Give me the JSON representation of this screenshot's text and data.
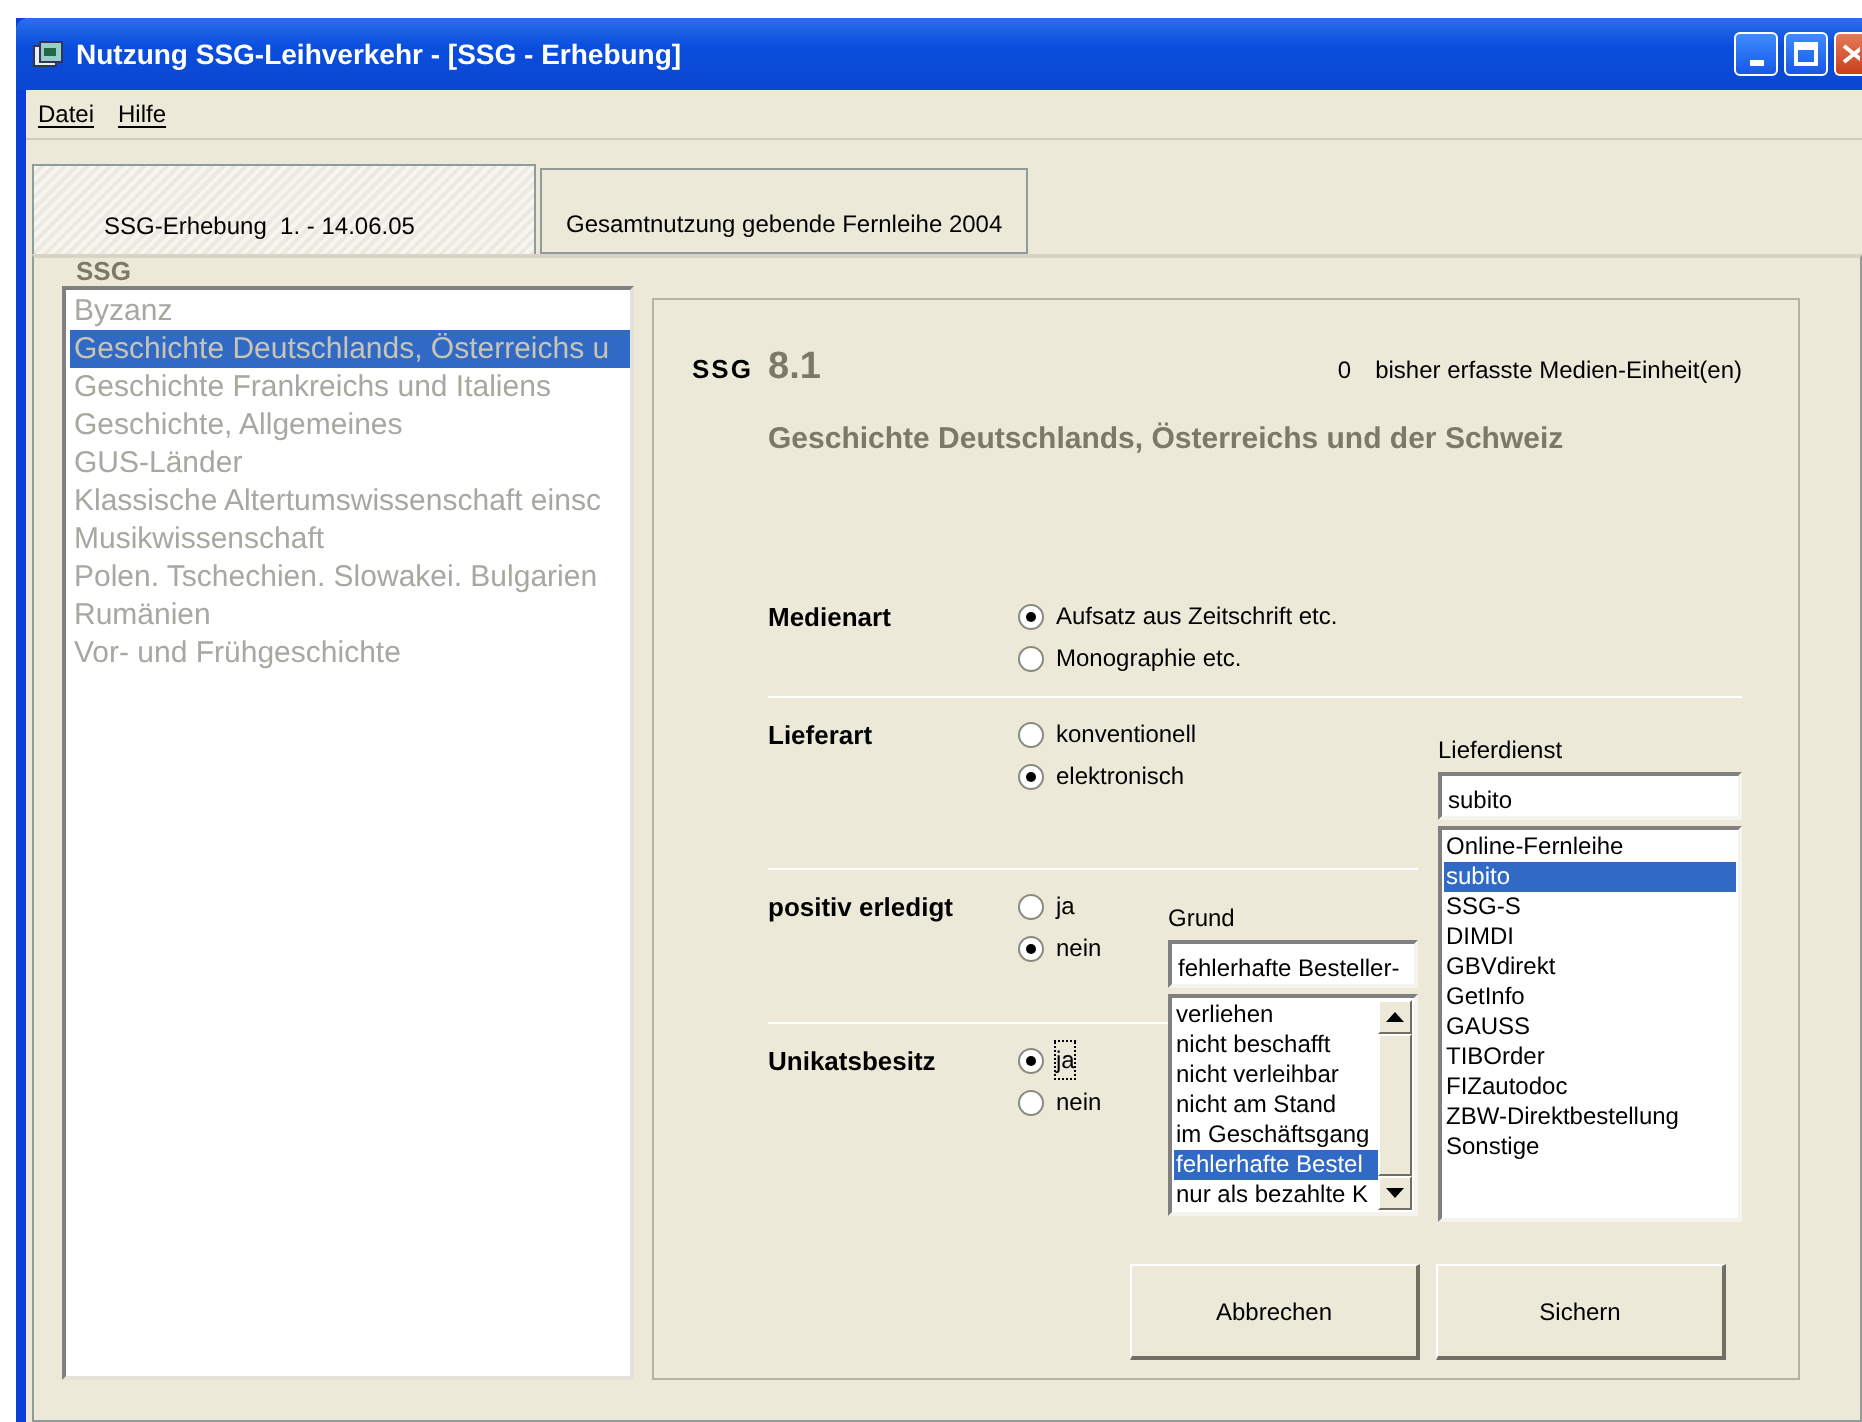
{
  "window": {
    "title": "Nutzung SSG-Leihverkehr - [SSG - Erhebung]"
  },
  "menu": [
    "Datei",
    "Hilfe"
  ],
  "tabs": [
    {
      "label": "SSG-Erhebung  1. - 14.06.05",
      "selected": true
    },
    {
      "label": "Gesamtnutzung gebende Fernleihe 2004",
      "selected": false
    }
  ],
  "ssg_list": {
    "label": "SSG",
    "items": [
      {
        "label": "Byzanz",
        "selected": false
      },
      {
        "label": "Geschichte Deutschlands, Österreichs u",
        "selected": true
      },
      {
        "label": "Geschichte Frankreichs und Italiens",
        "selected": false
      },
      {
        "label": "Geschichte, Allgemeines",
        "selected": false
      },
      {
        "label": "GUS-Länder",
        "selected": false
      },
      {
        "label": "Klassische Altertumswissenschaft einsc",
        "selected": false
      },
      {
        "label": "Musikwissenschaft",
        "selected": false
      },
      {
        "label": "Polen. Tschechien. Slowakei. Bulgarien",
        "selected": false
      },
      {
        "label": "Rumänien",
        "selected": false
      },
      {
        "label": "Vor- und Frühgeschichte",
        "selected": false
      }
    ]
  },
  "panel": {
    "ssg_label": "SSG",
    "number": "8.1",
    "count": "0",
    "count_label": "bisher erfasste Medien-Einheit(en)",
    "subject": "Geschichte Deutschlands, Österreichs und der Schweiz"
  },
  "sections": [
    {
      "label": "Medienart",
      "options": [
        {
          "label": "Aufsatz aus Zeitschrift etc.",
          "selected": true,
          "focused": false
        },
        {
          "label": "Monographie etc.",
          "selected": false,
          "focused": false
        }
      ]
    },
    {
      "label": "Lieferart",
      "options": [
        {
          "label": "konventionell",
          "selected": false,
          "focused": false
        },
        {
          "label": "elektronisch",
          "selected": true,
          "focused": false
        }
      ]
    },
    {
      "label": "positiv erledigt",
      "options": [
        {
          "label": "ja",
          "selected": false,
          "focused": false
        },
        {
          "label": "nein",
          "selected": true,
          "focused": false
        }
      ]
    },
    {
      "label": "Unikatsbesitz",
      "options": [
        {
          "label": "ja",
          "selected": true,
          "focused": true
        },
        {
          "label": "nein",
          "selected": false,
          "focused": false
        }
      ]
    }
  ],
  "grund": {
    "label": "Grund",
    "value": "fehlerhafte Besteller-",
    "items": [
      {
        "label": "verliehen",
        "selected": false
      },
      {
        "label": "nicht beschafft",
        "selected": false
      },
      {
        "label": "nicht verleihbar",
        "selected": false
      },
      {
        "label": "nicht am Stand",
        "selected": false
      },
      {
        "label": "im Geschäftsgang",
        "selected": false
      },
      {
        "label": "fehlerhafte Bestel",
        "selected": true
      },
      {
        "label": "nur als bezahlte K",
        "selected": false
      }
    ]
  },
  "lieferdienst": {
    "label": "Lieferdienst",
    "value": "subito",
    "items": [
      {
        "label": "Online-Fernleihe",
        "selected": false
      },
      {
        "label": "subito",
        "selected": true
      },
      {
        "label": "SSG-S",
        "selected": false
      },
      {
        "label": "DIMDI",
        "selected": false
      },
      {
        "label": "GBVdirekt",
        "selected": false
      },
      {
        "label": "GetInfo",
        "selected": false
      },
      {
        "label": "GAUSS",
        "selected": false
      },
      {
        "label": "TIBOrder",
        "selected": false
      },
      {
        "label": "FIZautodoc",
        "selected": false
      },
      {
        "label": "ZBW-Direktbestellung",
        "selected": false
      },
      {
        "label": "Sonstige",
        "selected": false
      }
    ]
  },
  "buttons": [
    "Abbrechen",
    "Sichern"
  ]
}
